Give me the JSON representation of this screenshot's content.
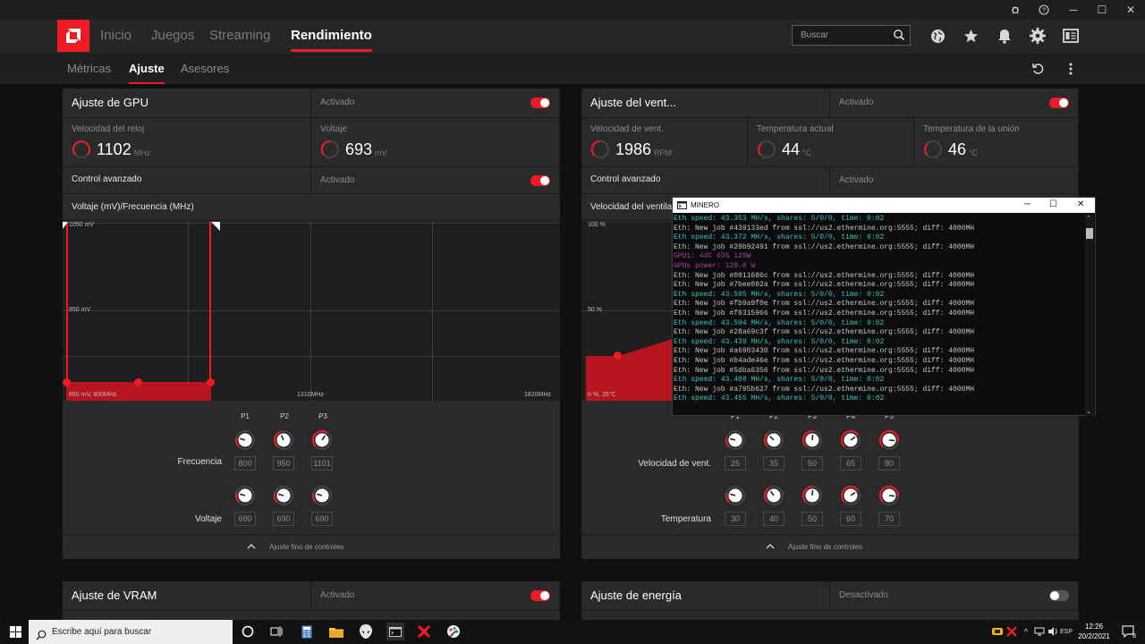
{
  "titlebar": {
    "bug_icon": "bug-icon",
    "help_icon": "help-icon",
    "minimize": "─",
    "maximize": "☐",
    "close": "✕"
  },
  "nav": {
    "tabs": [
      "Inicio",
      "Juegos",
      "Streaming",
      "Rendimiento"
    ],
    "active": "Rendimiento",
    "search_placeholder": "Buscar"
  },
  "subnav": {
    "tabs": [
      "Métricas",
      "Ajuste",
      "Asesores"
    ],
    "active": "Ajuste"
  },
  "gpu": {
    "title": "Ajuste de GPU",
    "status": "Activado",
    "clock_label": "Velocidad del reloj",
    "clock_value": "1102",
    "clock_unit": "MHz",
    "voltage_label": "Voltaje",
    "voltage_value": "693",
    "voltage_unit": "mV",
    "advanced_label": "Control avanzado",
    "advanced_status": "Activado",
    "curve_label": "Voltaje (mV)/Frecuencia (MHz)",
    "y_top": "1050 mV",
    "y_mid": "850 mV",
    "bottom_left": "650 mV, 800MHz",
    "x_mid": "1310MHz",
    "x_right": "1820MHz",
    "p_labels": [
      "P1",
      "P2",
      "P3"
    ],
    "freq_label": "Frecuencia",
    "freq_values": [
      "800",
      "950",
      "1101"
    ],
    "volt_label": "Voltaje",
    "volt_values": [
      "690",
      "690",
      "690"
    ],
    "fine_label": "Ajuste fino de controles"
  },
  "fan": {
    "title": "Ajuste del vent...",
    "status": "Activado",
    "speed_label": "Velocidad de vent.",
    "speed_value": "1986",
    "speed_unit": "RPM",
    "temp_label": "Temperatura actual",
    "temp_value": "44",
    "temp_unit": "°C",
    "junction_label": "Temperatura de la unión",
    "junction_value": "46",
    "junction_unit": "°C",
    "advanced_label": "Control avanzado",
    "advanced_status": "Activado",
    "curve_label": "Velocidad del ventila",
    "y_top": "100 %",
    "y_mid": "50 %",
    "bottom_left": "0 %, 25°C",
    "p_labels": [
      "P1",
      "P2",
      "P3",
      "P4",
      "P5"
    ],
    "speed_row_label": "Velocidad de vent.",
    "speed_values": [
      "25",
      "35",
      "50",
      "65",
      "80"
    ],
    "temp_row_label": "Temperatura",
    "temp_values": [
      "30",
      "40",
      "50",
      "60",
      "70"
    ],
    "fine_label": "Ajuste fino de controles"
  },
  "vram": {
    "title": "Ajuste de VRAM",
    "status": "Activado"
  },
  "power": {
    "title": "Ajuste de energía",
    "status": "Desactivado"
  },
  "terminal": {
    "title": "MINERO",
    "lines": [
      {
        "t": "Eth speed: 43.353 MH/s, shares: 5/0/0, time: 0:02",
        "c": "#3fc2c2"
      },
      {
        "t": "Eth: New job #439133ed from ssl://us2.ethermine.org:5555; diff: 4000MH",
        "c": "#c8c8c8"
      },
      {
        "t": "Eth speed: 43.372 MH/s, shares: 5/0/0, time: 0:02",
        "c": "#3fc2c2"
      },
      {
        "t": "Eth: New job #29b92491 from ssl://us2.ethermine.org:5555; diff: 4000MH",
        "c": "#c8c8c8"
      },
      {
        "t": "GPU1: 44C 65% 120W",
        "c": "#b03ab0"
      },
      {
        "t": "GPUs power: 120.0 W",
        "c": "#b03ab0"
      },
      {
        "t": "Eth: New job #0911686c from ssl://us2.ethermine.org:5555; diff: 4000MH",
        "c": "#c8c8c8"
      },
      {
        "t": "Eth: New job #7bee082a from ssl://us2.ethermine.org:5555; diff: 4000MH",
        "c": "#c8c8c8"
      },
      {
        "t": "Eth speed: 43.505 MH/s, shares: 5/0/0, time: 0:02",
        "c": "#3fc2c2"
      },
      {
        "t": "Eth: New job #fb9a9f0e from ssl://us2.ethermine.org:5555; diff: 4000MH",
        "c": "#c8c8c8"
      },
      {
        "t": "Eth: New job #f8315966 from ssl://us2.ethermine.org:5555; diff: 4000MH",
        "c": "#c8c8c8"
      },
      {
        "t": "Eth speed: 43.594 MH/s, shares: 5/0/0, time: 0:02",
        "c": "#3fc2c2"
      },
      {
        "t": "Eth: New job #28a69c3f from ssl://us2.ethermine.org:5555; diff: 4000MH",
        "c": "#c8c8c8"
      },
      {
        "t": "Eth speed: 43.439 MH/s, shares: 5/0/0, time: 0:02",
        "c": "#3fc2c2"
      },
      {
        "t": "Eth: New job #a6903430 from ssl://us2.ethermine.org:5555; diff: 4000MH",
        "c": "#c8c8c8"
      },
      {
        "t": "Eth: New job #b4ade46e from ssl://us2.ethermine.org:5555; diff: 4000MH",
        "c": "#c8c8c8"
      },
      {
        "t": "Eth: New job #5dba6356 from ssl://us2.ethermine.org:5555; diff: 4000MH",
        "c": "#c8c8c8"
      },
      {
        "t": "Eth speed: 43.408 MH/s, shares: 5/0/0, time: 0:02",
        "c": "#3fc2c2"
      },
      {
        "t": "Eth: New job #a795b627 from ssl://us2.ethermine.org:5555; diff: 4000MH",
        "c": "#c8c8c8"
      },
      {
        "t": "Eth speed: 43.455 MH/s, shares: 5/0/0, time: 0:02",
        "c": "#3fc2c2"
      }
    ]
  },
  "taskbar": {
    "search_placeholder": "Escribe aquí para buscar",
    "time": "12:26",
    "date": "20/2/2021",
    "notif_count": "6"
  }
}
